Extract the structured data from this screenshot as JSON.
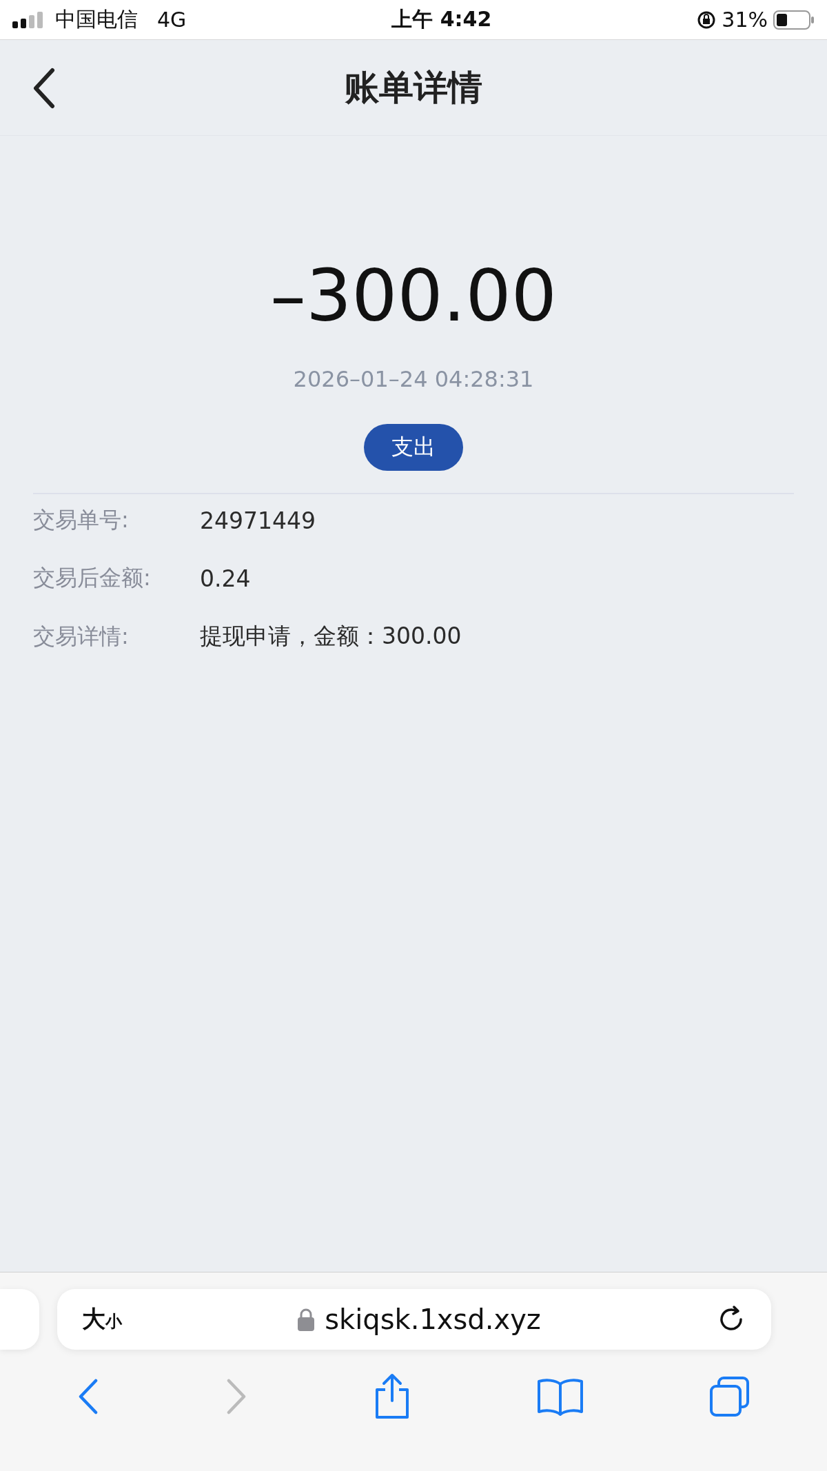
{
  "status_bar": {
    "carrier": "中国电信",
    "network": "4G",
    "time": "上午 4:42",
    "battery": "31%"
  },
  "nav": {
    "title": "账单详情"
  },
  "bill": {
    "amount": "–300.00",
    "datetime": "2026–01–24 04:28:31",
    "type_badge": "支出"
  },
  "details": [
    {
      "label": "交易单号:",
      "value": "24971449"
    },
    {
      "label": "交易后金额:",
      "value": "0.24"
    },
    {
      "label": "交易详情:",
      "value": "提现申请，金额：300.00"
    }
  ],
  "browser": {
    "text_size": {
      "big": "大",
      "small": "小"
    },
    "url": "skiqsk.1xsd.xyz",
    "back_disabled": false,
    "forward_disabled": true
  }
}
